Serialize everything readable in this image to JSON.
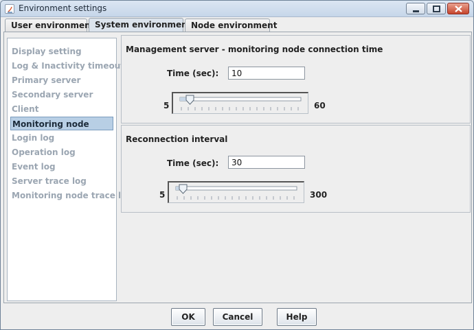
{
  "window": {
    "title": "Environment settings"
  },
  "tabs": [
    {
      "label": "User environment",
      "selected": false
    },
    {
      "label": "System environment",
      "selected": true
    },
    {
      "label": "Node environment",
      "selected": false
    }
  ],
  "sidebar": {
    "items": [
      {
        "label": "Display setting",
        "selected": false
      },
      {
        "label": "Log & Inactivity timeout",
        "selected": false
      },
      {
        "label": "Primary server",
        "selected": false
      },
      {
        "label": "Secondary server",
        "selected": false
      },
      {
        "label": "Client",
        "selected": false
      },
      {
        "label": "Monitoring node",
        "selected": true
      },
      {
        "label": "Login log",
        "selected": false
      },
      {
        "label": "Operation log",
        "selected": false
      },
      {
        "label": "Event log",
        "selected": false
      },
      {
        "label": "Server trace log",
        "selected": false
      },
      {
        "label": "Monitoring node trace log",
        "selected": false
      }
    ]
  },
  "connection_panel": {
    "title": "Management server - monitoring node connection time",
    "time_label": "Time (sec):",
    "time_value": "10",
    "slider": {
      "min": "5",
      "max": "60",
      "value": 10
    }
  },
  "reconnection_panel": {
    "title": "Reconnection interval",
    "time_label": "Time (sec):",
    "time_value": "30",
    "slider": {
      "min": "5",
      "max": "300",
      "value": 30
    }
  },
  "buttons": {
    "ok": "OK",
    "cancel": "Cancel",
    "help": "Help"
  },
  "colors": {
    "selection_bg": "#b8cfe5",
    "disabled_text": "#9ba6b2"
  }
}
